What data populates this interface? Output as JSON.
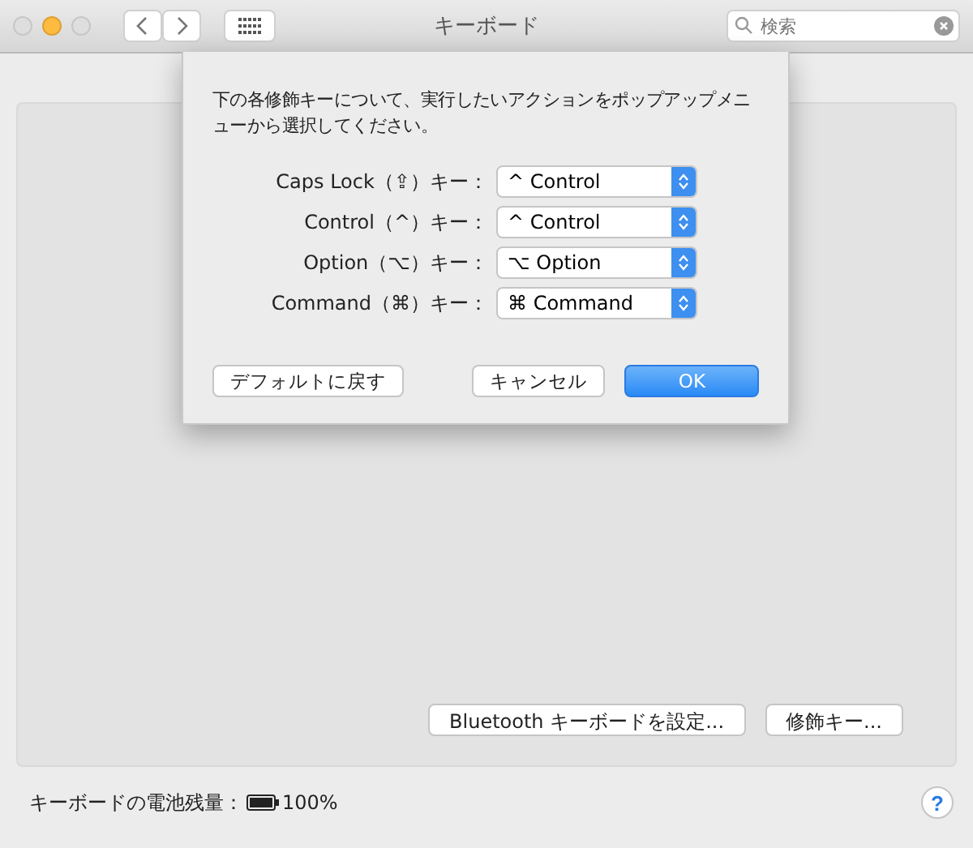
{
  "window": {
    "title": "キーボード"
  },
  "search": {
    "placeholder": "検索"
  },
  "dialog": {
    "message": "下の各修飾キーについて、実行したいアクションをポップアップメニューから選択してください。",
    "rows": [
      {
        "label": "Caps Lock（⇪）キー：",
        "value": "^ Control"
      },
      {
        "label": "Control（^）キー：",
        "value": "^ Control"
      },
      {
        "label": "Option（⌥）キー：",
        "value": "⌥ Option"
      },
      {
        "label": "Command（⌘）キー：",
        "value": "⌘ Command"
      }
    ],
    "buttons": [
      {
        "label": "デフォルトに戻す",
        "kind": "plain"
      },
      {
        "label": "キャンセル",
        "kind": "plain"
      },
      {
        "label": "OK",
        "kind": "default"
      }
    ]
  },
  "panel_buttons": [
    "Bluetooth キーボードを設定...",
    "修飾キー..."
  ],
  "footer": {
    "battery_label": "キーボードの電池残量：",
    "battery_value": "100%",
    "help": "?"
  }
}
